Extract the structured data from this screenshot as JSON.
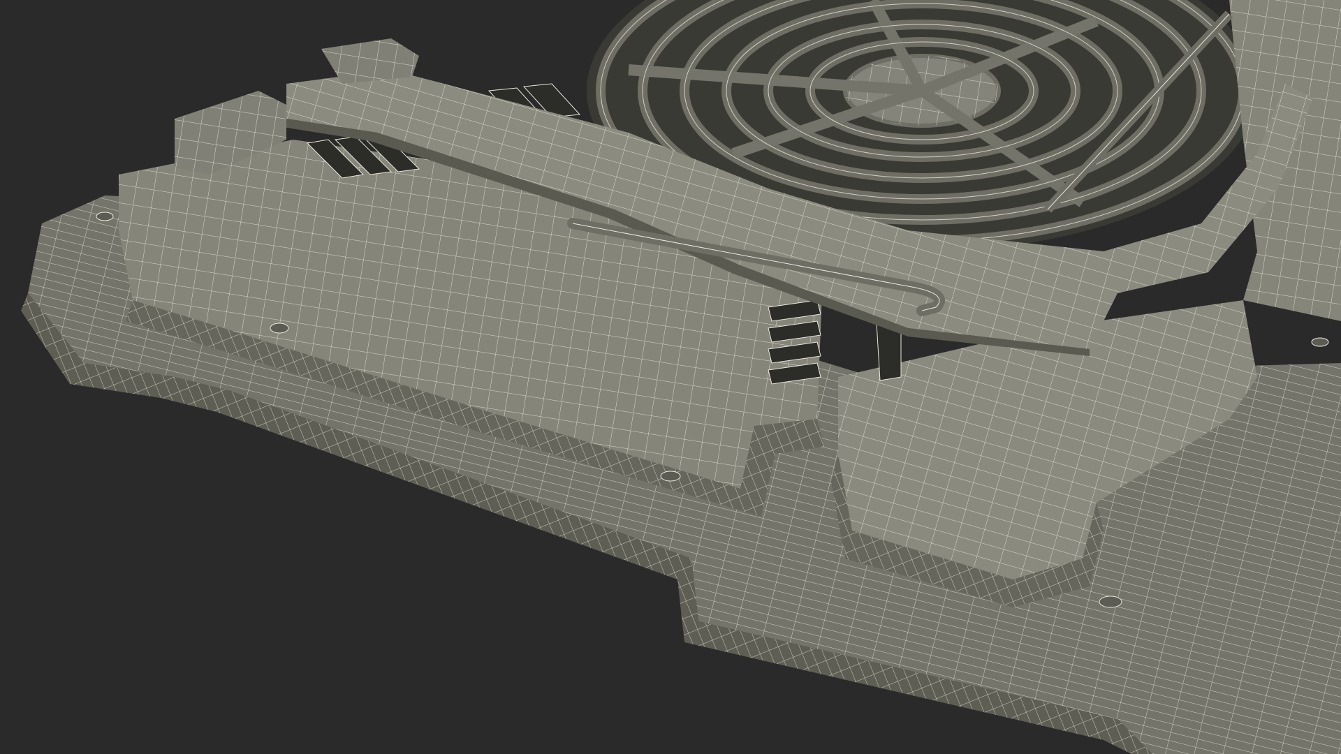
{
  "scene": {
    "subject": "laptop-cooling-pad",
    "render_mode": "wireframe-over-shaded",
    "colors": {
      "background": "#2a2a2a",
      "surface_top": "#8b8b7e",
      "surface_mid": "#7a7a6e",
      "surface_side": "#6b6b60",
      "surface_dark": "#565650",
      "vent_shadow": "#2c2c28",
      "wire": "#e9e9dc"
    },
    "features": [
      "base-plate",
      "raised-deck",
      "fan-grille",
      "handle-bar",
      "front-wire-rod",
      "vent-slots",
      "screw-holes"
    ]
  }
}
